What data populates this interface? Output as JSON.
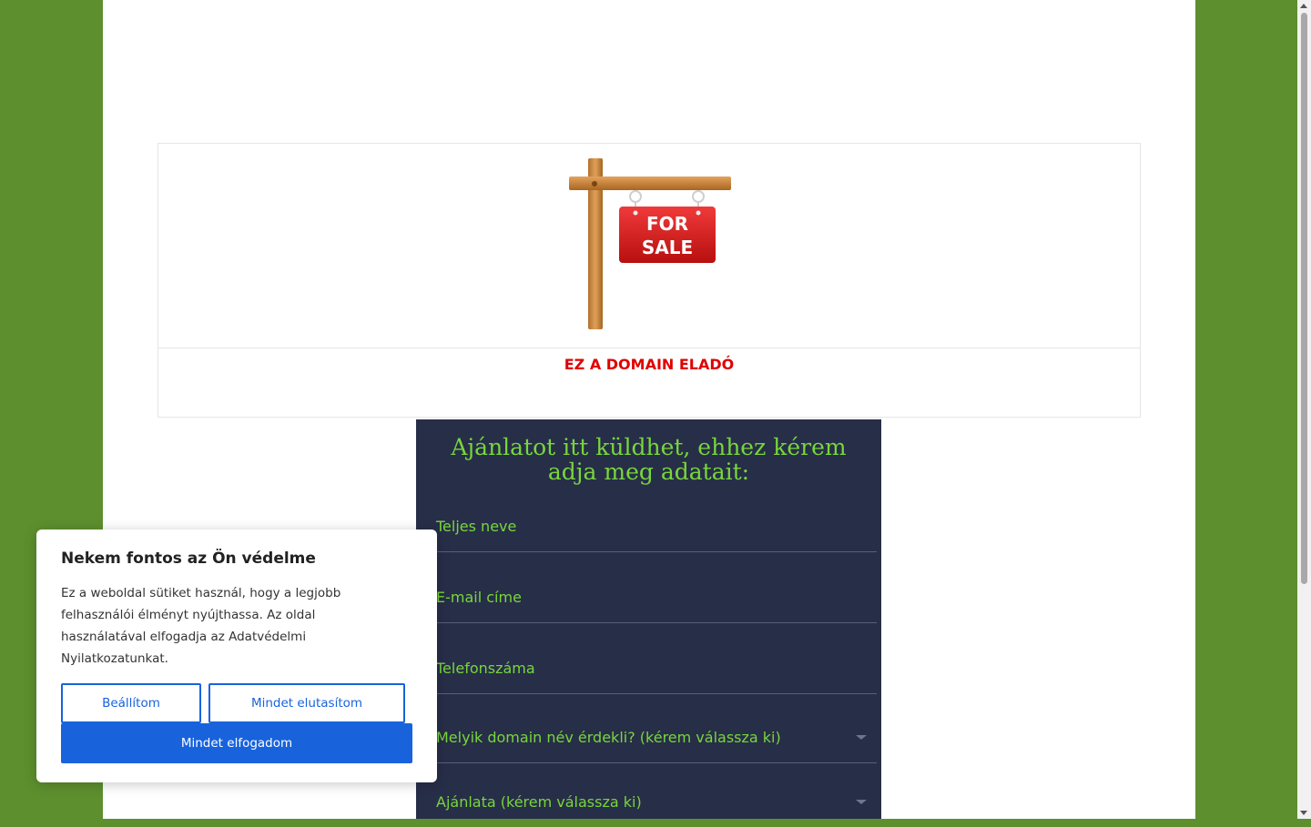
{
  "sale_card": {
    "sign_text_line1": "FOR",
    "sign_text_line2": "SALE",
    "title": "EZ A DOMAIN ELADÓ"
  },
  "form": {
    "title": "Ajánlatot itt küldhet, ehhez kérem adja meg adatait:",
    "fields": [
      {
        "label": "Teljes neve",
        "type": "text"
      },
      {
        "label": "E-mail címe",
        "type": "text"
      },
      {
        "label": "Telefonszáma",
        "type": "text"
      },
      {
        "label": "Melyik domain név érdekli? (kérem válassza ki)",
        "type": "select"
      },
      {
        "label": "Ajánlata (kérem válassza ki)",
        "type": "select"
      }
    ]
  },
  "cookie_banner": {
    "title": "Nekem fontos az Ön védelme",
    "body": "Ez a weboldal sütiket használ, hogy a legjobb felhasználói élményt nyújthassa. Az oldal használatával elfogadja az Adatvédelmi Nyilatkozatunkat.",
    "settings_label": "Beállítom",
    "reject_label": "Mindet elutasítom",
    "accept_label": "Mindet elfogadom"
  },
  "colors": {
    "background_green": "#5d8f2e",
    "form_background": "#272e48",
    "form_accent": "#78d63b",
    "sale_red": "#e00000",
    "button_blue": "#1863dc"
  }
}
